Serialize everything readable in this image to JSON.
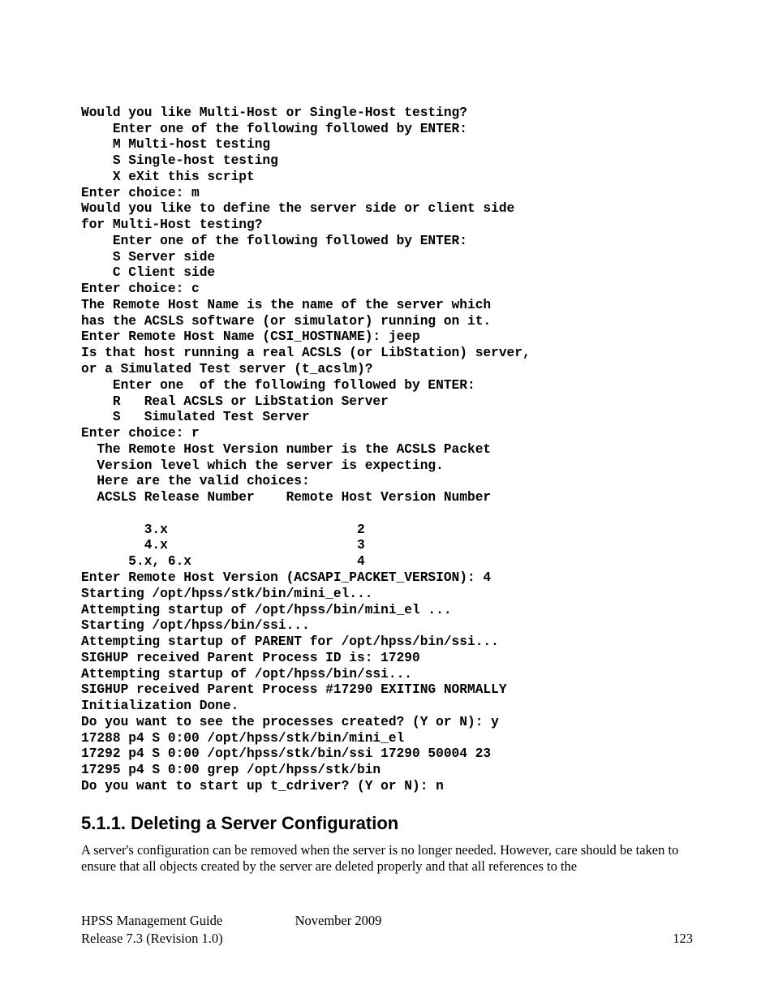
{
  "terminal": {
    "l1": "Would you like Multi-Host or Single-Host testing?",
    "l2": "    Enter one of the following followed by ENTER:",
    "l3": "    M Multi-host testing",
    "l4": "    S Single-host testing",
    "l5": "    X eXit this script",
    "l6": "Enter choice: m",
    "l7": "Would you like to define the server side or client side",
    "l8": "for Multi-Host testing?",
    "l9": "    Enter one of the following followed by ENTER:",
    "l10": "    S Server side",
    "l11": "    C Client side",
    "l12": "Enter choice: c",
    "l13": "The Remote Host Name is the name of the server which",
    "l14": "has the ACSLS software (or simulator) running on it.",
    "l15": "Enter Remote Host Name (CSI_HOSTNAME): jeep",
    "l16": "Is that host running a real ACSLS (or LibStation) server,",
    "l17": "or a Simulated Test server (t_acslm)?",
    "l18": "    Enter one  of the following followed by ENTER:",
    "l19": "    R   Real ACSLS or LibStation Server",
    "l20": "    S   Simulated Test Server",
    "l21": "Enter choice: r",
    "l22": "  The Remote Host Version number is the ACSLS Packet",
    "l23": "  Version level which the server is expecting.",
    "l24": "  Here are the valid choices:",
    "l25": "  ACSLS Release Number    Remote Host Version Number",
    "l26": "",
    "l27": "        3.x                        2",
    "l28": "        4.x                        3",
    "l29": "      5.x, 6.x                     4",
    "l30": "Enter Remote Host Version (ACSAPI_PACKET_VERSION): 4",
    "l31": "Starting /opt/hpss/stk/bin/mini_el...",
    "l32": "Attempting startup of /opt/hpss/bin/mini_el ...",
    "l33": "Starting /opt/hpss/bin/ssi...",
    "l34": "Attempting startup of PARENT for /opt/hpss/bin/ssi...",
    "l35": "SIGHUP received Parent Process ID is: 17290",
    "l36": "Attempting startup of /opt/hpss/bin/ssi...",
    "l37": "SIGHUP received Parent Process #17290 EXITING NORMALLY",
    "l38": "Initialization Done.",
    "l39": "Do you want to see the processes created? (Y or N): y",
    "l40": "17288 p4 S 0:00 /opt/hpss/stk/bin/mini_el",
    "l41": "17292 p4 S 0:00 /opt/hpss/stk/bin/ssi 17290 50004 23",
    "l42": "17295 p4 S 0:00 grep /opt/hpss/stk/bin",
    "l43": "Do you want to start up t_cdriver? (Y or N): n"
  },
  "section": {
    "heading": "5.1.1. Deleting a Server Configuration",
    "body": "A server's configuration can be removed when the server is no longer needed. However, care should be taken to ensure that all objects created by the server are deleted properly and that all references to the"
  },
  "footer": {
    "guide": "HPSS Management Guide",
    "date": "November 2009",
    "release": "Release 7.3 (Revision 1.0)",
    "page": "123"
  }
}
